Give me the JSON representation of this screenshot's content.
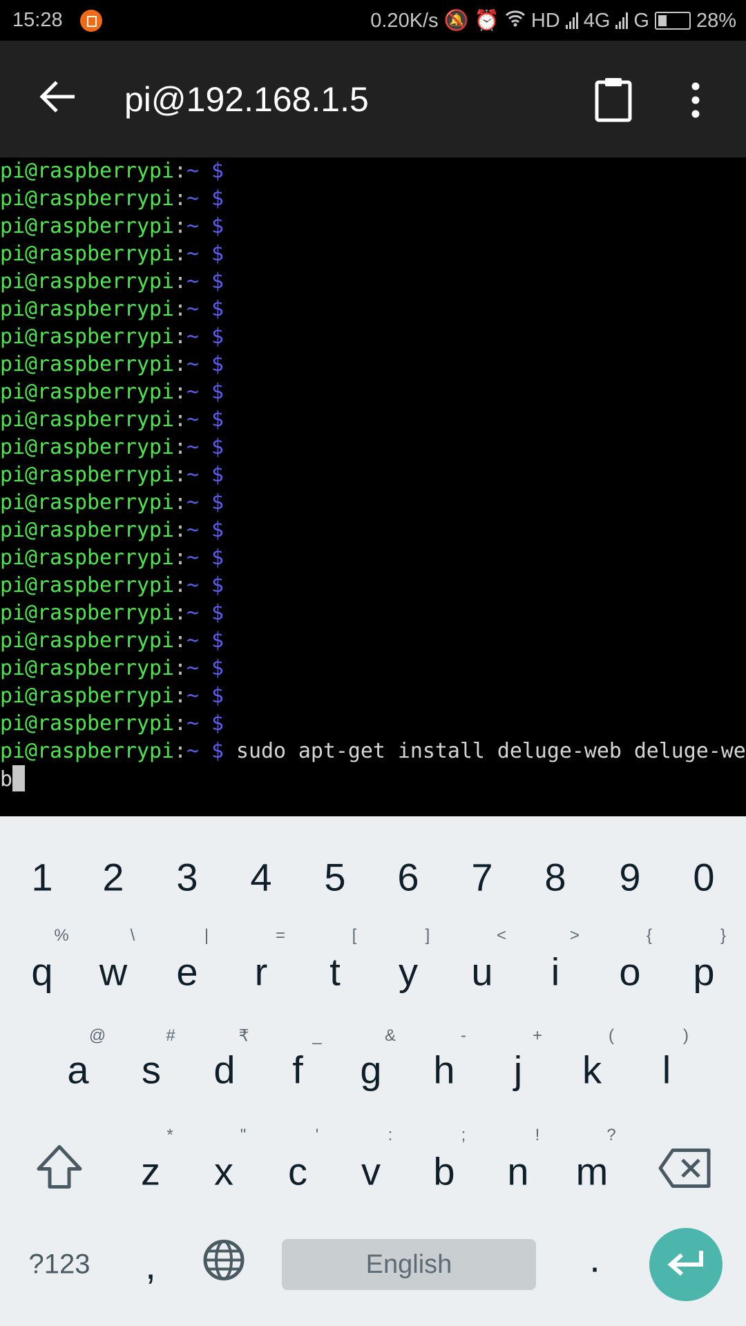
{
  "status_bar": {
    "time": "15:28",
    "net_speed": "0.20K/s",
    "hd": "HD",
    "net1": "4G",
    "net2": "G",
    "battery": "28%",
    "battery_level": 0.28
  },
  "app_bar": {
    "title": "pi@192.168.1.5",
    "back_icon": "arrow-left",
    "clipboard_icon": "clipboard",
    "more_icon": "more-vertical"
  },
  "terminal": {
    "prompt": {
      "user": "pi@raspberrypi",
      "colon": ":",
      "dir": "~",
      "dollar": "$"
    },
    "lines": [
      "",
      "",
      "",
      "",
      "",
      "",
      "",
      "",
      "",
      "",
      "",
      "",
      "",
      "",
      "",
      "",
      "",
      "",
      "",
      "",
      "",
      "sudo apt-get install deluge-web deluge-web"
    ],
    "colors": {
      "user": "#4be84b",
      "dollar": "#5c5cf0",
      "text": "#d6d6d6"
    }
  },
  "keyboard": {
    "numbers": [
      "1",
      "2",
      "3",
      "4",
      "5",
      "6",
      "7",
      "8",
      "9",
      "0"
    ],
    "row1": [
      "q",
      "w",
      "e",
      "r",
      "t",
      "y",
      "u",
      "i",
      "o",
      "p"
    ],
    "row1_hints": [
      "%",
      "\\",
      "|",
      "=",
      "[",
      "]",
      "<",
      ">",
      "{",
      "}"
    ],
    "row2": [
      "a",
      "s",
      "d",
      "f",
      "g",
      "h",
      "j",
      "k",
      "l"
    ],
    "row2_hints": [
      "@",
      "#",
      "₹",
      "_",
      "&",
      "-",
      "+",
      "(",
      ")"
    ],
    "row3": [
      "z",
      "x",
      "c",
      "v",
      "b",
      "n",
      "m"
    ],
    "row3_hints": [
      "*",
      "\"",
      "'",
      ":",
      ";",
      "!",
      "?"
    ],
    "symbols_label": "?123",
    "comma": ",",
    "period": ".",
    "space_label": "English",
    "enter_color": "#4db6ac"
  }
}
